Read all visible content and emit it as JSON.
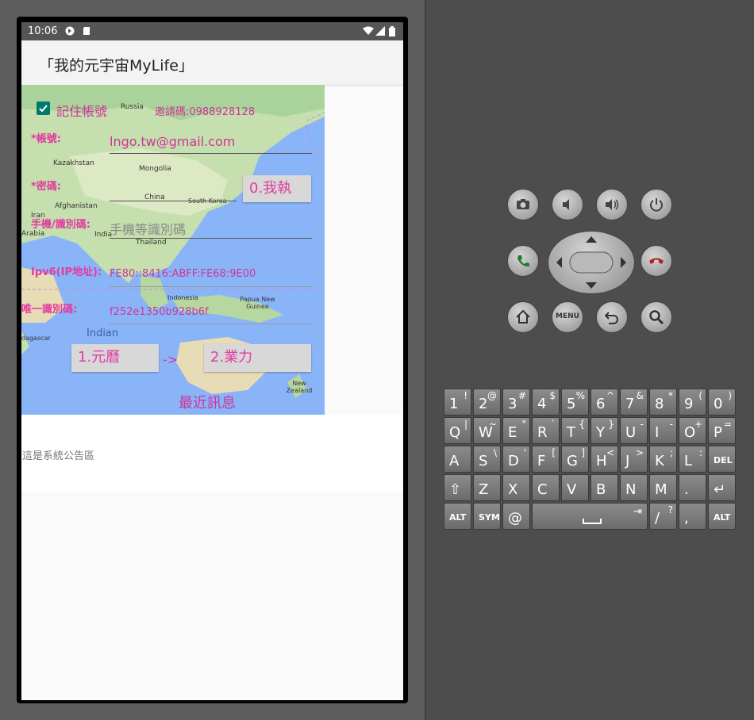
{
  "status_bar": {
    "time": "10:06"
  },
  "app": {
    "title": "「我的元宇宙MyLife」"
  },
  "form": {
    "remember_label": "記住帳號",
    "invite_code": "邀請碼:0988928128",
    "account_label": "*帳號:",
    "account_value": "lngo.tw@gmail.com",
    "password_label": "*密碼:",
    "phone_label": "手機/識別碼:",
    "phone_placeholder": "手機等識別碼",
    "ipv6_label": "Ipv6(IP地址):",
    "ipv6_value": "FE80::8416:ABFF:FE68:9E00",
    "uid_label": "唯一識別碼:",
    "uid_value": "f252e1350b928b6f",
    "btn_exec": "0.我執",
    "btn_calendar": "1.元曆",
    "arrow": "->",
    "btn_karma": "2.業力",
    "recent": "最近訊息"
  },
  "map_labels": {
    "russia": "Russia",
    "kazakhstan": "Kazakhstan",
    "mongolia": "Mongolia",
    "china": "China",
    "south_korea": "South Korea",
    "afghanistan": "Afghanistan",
    "iran": "Iran",
    "arabia": "Arabia",
    "india": "India",
    "thailand": "Thailand",
    "indonesia": "Indonesia",
    "png": "Papua New Guinea",
    "indian": "Indian",
    "madagascar": "dagascar",
    "new_zealand": "New Zealand"
  },
  "notice": {
    "text": "這是系統公告區"
  },
  "keyboard": {
    "row1": [
      [
        "1",
        "!"
      ],
      [
        "2",
        "@"
      ],
      [
        "3",
        "#"
      ],
      [
        "4",
        "$"
      ],
      [
        "5",
        "%"
      ],
      [
        "6",
        "^"
      ],
      [
        "7",
        "&"
      ],
      [
        "8",
        "*"
      ],
      [
        "9",
        "("
      ],
      [
        "0",
        ")"
      ]
    ],
    "row2": [
      [
        "Q",
        "|"
      ],
      [
        "W",
        "~"
      ],
      [
        "E",
        "\""
      ],
      [
        "R",
        "`"
      ],
      [
        "T",
        "{"
      ],
      [
        "Y",
        "}"
      ],
      [
        "U",
        "-"
      ],
      [
        "I",
        "-"
      ],
      [
        "O",
        "+"
      ],
      [
        "P",
        "="
      ]
    ],
    "row3": [
      [
        "A",
        ""
      ],
      [
        "S",
        "\\"
      ],
      [
        "D",
        "'"
      ],
      [
        "F",
        "["
      ],
      [
        "G",
        "]"
      ],
      [
        "H",
        "<"
      ],
      [
        "J",
        ">"
      ],
      [
        "K",
        ";"
      ],
      [
        "L",
        ":"
      ],
      [
        "DEL",
        ""
      ]
    ],
    "row4": [
      [
        "⇧",
        ""
      ],
      [
        "Z",
        ""
      ],
      [
        "X",
        ""
      ],
      [
        "C",
        ""
      ],
      [
        "V",
        ""
      ],
      [
        "B",
        ""
      ],
      [
        "N",
        ""
      ],
      [
        "M",
        ""
      ],
      [
        ".",
        ""
      ],
      [
        "↵",
        ""
      ]
    ],
    "alt": "ALT",
    "sym": "SYM",
    "at": "@",
    "slash": "/",
    "question": "?",
    "comma": ",",
    "alt2": "ALT"
  },
  "controls": {
    "menu": "MENU"
  }
}
